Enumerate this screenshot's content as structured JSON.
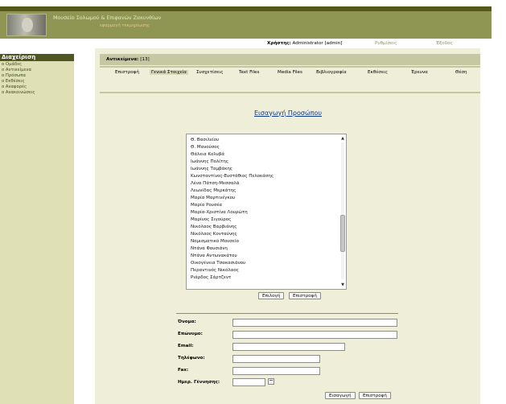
{
  "header": {
    "site_title": "Μουσείο Σολωμού & Επιφανών Ζακυνθίων",
    "site_subtitle": "εφαρμογή τεκμηρίωσης",
    "user_label": "Χρήστης:",
    "user_value": "Administrator [admin]",
    "settings_link": "Ρυθμίσεις",
    "logout_link": "Έξοδος"
  },
  "sidebar": {
    "title": "Διαχείριση",
    "items": [
      {
        "label": "o Ομάδες"
      },
      {
        "label": "o Αντικείμενα"
      },
      {
        "label": "o Πρόσωπα"
      },
      {
        "label": "o Εκθέσεις"
      },
      {
        "label": "o Αναφορές"
      },
      {
        "label": "o Ανακοινώσεις"
      }
    ]
  },
  "main": {
    "count_label": "Αντικείμενα:",
    "count_value": "[13]",
    "tabs": [
      {
        "label": "Επιστροφή"
      },
      {
        "label": "Γενικά Στοιχεία"
      },
      {
        "label": "Συσχετίσεις"
      },
      {
        "label": "Text Files"
      },
      {
        "label": "Media Files"
      },
      {
        "label": "Βιβλιογραφία"
      },
      {
        "label": "Εκθέσεις"
      },
      {
        "label": "Έρευνα"
      },
      {
        "label": "Θέση"
      }
    ],
    "page_heading": "Εισαγωγή Προσώπου",
    "list_options": [
      "Θ. Βασιλείου",
      "Θ. Μανούσος",
      "Θάλεια Κολυβά",
      "Ιωάννης Πολίτης",
      "Ιωάννης Ταμβάκης",
      "Κωνσταντίνος-Ευστάθιος Πελοκάσης",
      "Λένα Πάτση-Μεσσαλά",
      "Λεωνίδας Μερκάτης",
      "Μαρία Μαρτινέγκου",
      "Μαρία Ρουσέα",
      "Μαρία-Χριστίνα Λουρώτη",
      "Μαρίνος Σιγούρος",
      "Νικόλαος Βαρβιάνης",
      "Νικόλαος Κονταύνης",
      "Νομισματικό Μουσείο",
      "Ντάνα Φουσιάνη",
      "Ντάνα Αντωνακάτου",
      "Οικογένεια Τσακασιάνου",
      "Περαντινός Νικόλαος",
      "Ριάρδος Σάρτζεντ"
    ],
    "select_button": "Επιλογή",
    "back_button": "Επιστροφή",
    "form": {
      "name_label": "Όνομα:",
      "surname_label": "Επώνυμο:",
      "email_label": "Email:",
      "phone_label": "Τηλέφωνο:",
      "fax_label": "Fax:",
      "birthdate_label": "Ημερ. Γέννησης:",
      "name_value": "",
      "surname_value": "",
      "email_value": "",
      "phone_value": "",
      "fax_value": "",
      "birthdate_value": "",
      "insert_button": "Εισαγωγή",
      "back_button": "Επιστροφή"
    }
  },
  "colors": {
    "header_bg": "#8f9553",
    "header_dark": "#56571a",
    "sidebar_bg": "#dfe0b5",
    "sidebar_title_bg": "#4f5622",
    "main_bg": "#efeed8",
    "heading_link": "#0f3a8a"
  }
}
